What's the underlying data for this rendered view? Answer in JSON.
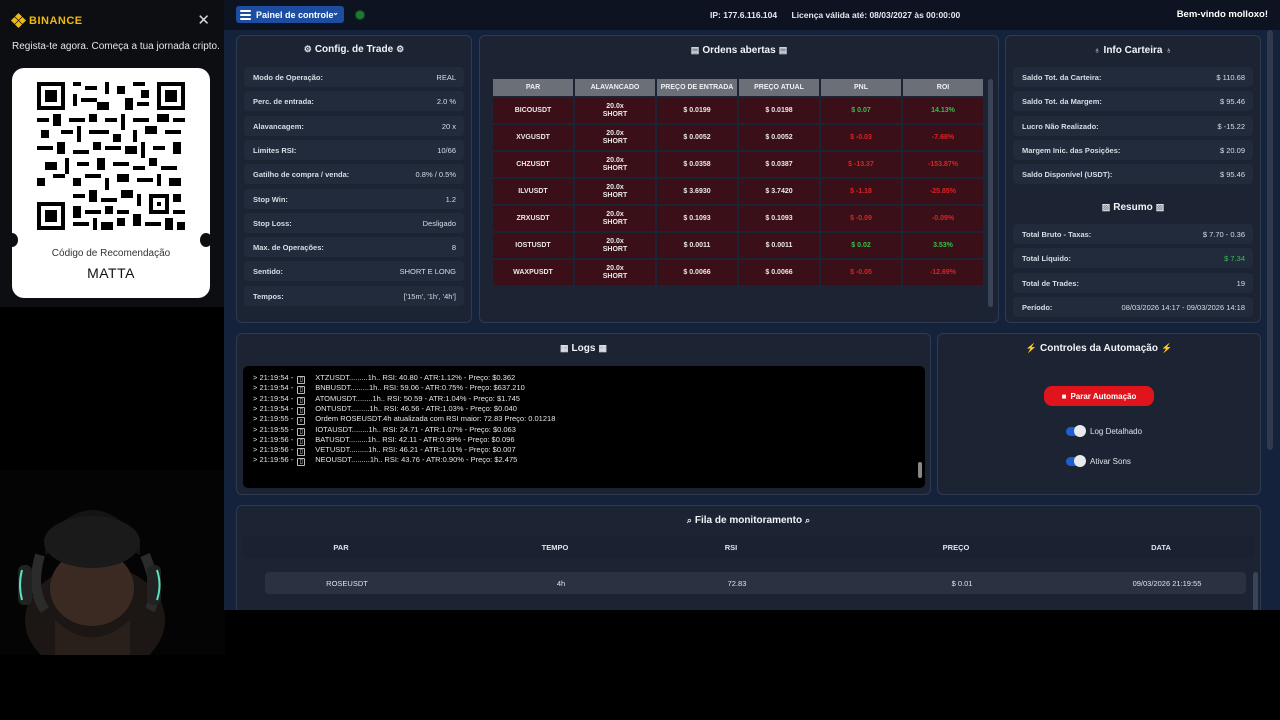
{
  "binance": {
    "brand": "BINANCE",
    "close_glyph": "✕",
    "tagline": "Regista-te agora. Começa a tua jornada cripto.",
    "referral_label": "Código de Recomendação",
    "referral_code": "MATTA"
  },
  "topbar": {
    "menu_label": "Painel de controle",
    "menu_chevron": "⌄",
    "ip": "IP: 177.6.116.104",
    "license": "Licença válida até: 08/03/2027 às 00:00:00",
    "welcome": "Bem-vindo molloxo!",
    "status_color": "#1e7a2e"
  },
  "config": {
    "title": "Config. de Trade",
    "icon": "gear-icon",
    "rows": [
      {
        "label": "Modo de Operação:",
        "value": "REAL"
      },
      {
        "label": "Perc. de entrada:",
        "value": "2.0 %"
      },
      {
        "label": "Alavancagem:",
        "value": "20 x"
      },
      {
        "label": "Limites RSI:",
        "value": "10/66"
      },
      {
        "label": "Gatilho de compra / venda:",
        "value": "0.8% / 0.5%"
      },
      {
        "label": "Stop Win:",
        "value": "1.2"
      },
      {
        "label": "Stop Loss:",
        "value": "Desligado"
      },
      {
        "label": "Max. de Operações:",
        "value": "8"
      },
      {
        "label": "Sentido:",
        "value": "SHORT E LONG"
      },
      {
        "label": "Tempos:",
        "value": "['15m', '1h', '4h']"
      }
    ]
  },
  "orders": {
    "title": "Ordens abertas",
    "headers": [
      "PAR",
      "ALAVANCADO",
      "PREÇO DE ENTRADA",
      "PREÇO ATUAL",
      "PNL",
      "ROI"
    ],
    "rows": [
      {
        "pair": "BICOUSDT",
        "lev1": "20.0x",
        "lev2": "SHORT",
        "entry": "$ 0.0199",
        "current": "$ 0.0198",
        "pnl": "$ 0.07",
        "roi": "14.13%",
        "sign": "pos"
      },
      {
        "pair": "XVGUSDT",
        "lev1": "20.0x",
        "lev2": "SHORT",
        "entry": "$ 0.0052",
        "current": "$ 0.0052",
        "pnl": "$ -0.03",
        "roi": "-7.68%",
        "sign": "neg"
      },
      {
        "pair": "CHZUSDT",
        "lev1": "20.0x",
        "lev2": "SHORT",
        "entry": "$ 0.0358",
        "current": "$ 0.0387",
        "pnl": "$ -13.37",
        "roi": "-153.87%",
        "sign": "neg"
      },
      {
        "pair": "ILVUSDT",
        "lev1": "20.0x",
        "lev2": "SHORT",
        "entry": "$ 3.6930",
        "current": "$ 3.7420",
        "pnl": "$ -1.18",
        "roi": "-25.85%",
        "sign": "neg"
      },
      {
        "pair": "ZRXUSDT",
        "lev1": "20.0x",
        "lev2": "SHORT",
        "entry": "$ 0.1093",
        "current": "$ 0.1093",
        "pnl": "$ -0.09",
        "roi": "-0.09%",
        "sign": "neg"
      },
      {
        "pair": "IOSTUSDT",
        "lev1": "20.0x",
        "lev2": "SHORT",
        "entry": "$ 0.0011",
        "current": "$ 0.0011",
        "pnl": "$ 0.02",
        "roi": "3.53%",
        "sign": "pos"
      },
      {
        "pair": "WAXPUSDT",
        "lev1": "20.0x",
        "lev2": "SHORT",
        "entry": "$ 0.0066",
        "current": "$ 0.0066",
        "pnl": "$ -0.05",
        "roi": "-12.69%",
        "sign": "neg"
      }
    ]
  },
  "wallet": {
    "title": "Info Carteira",
    "rows": [
      {
        "label": "Saldo Tot. da Carteira:",
        "value": "$ 110.68"
      },
      {
        "label": "Saldo Tot. da Margem:",
        "value": "$ 95.46"
      },
      {
        "label": "Lucro Não Realizado:",
        "value": "$ -15.22"
      },
      {
        "label": "Margem Inic. das Posições:",
        "value": "$ 20.09"
      },
      {
        "label": "Saldo Disponível (USDT):",
        "value": "$ 95.46"
      }
    ],
    "summary_title": "Resumo",
    "summary": [
      {
        "label": "Total Bruto - Taxas:",
        "value": "$ 7.70 - 0.36"
      },
      {
        "label": "Total Líquido:",
        "value": "$ 7.34"
      },
      {
        "label": "Total de Trades:",
        "value": "19"
      },
      {
        "label": "Período:",
        "value": "08/03/2026 14:17 - 09/03/2026 14:18"
      }
    ]
  },
  "logs": {
    "title": "Logs",
    "lines": [
      {
        "time": "> 21:19:54 -",
        "icon": "▯",
        "text": "XTZUSDT.........1h.. RSI: 40.80 - ATR:1.12% - Preço: $0.362"
      },
      {
        "time": "> 21:19:54 -",
        "icon": "▯",
        "text": "BNBUSDT.........1h.. RSI: 59.06 - ATR:0.75% - Preço: $637.210"
      },
      {
        "time": "> 21:19:54 -",
        "icon": "▯",
        "text": "ATOMUSDT........1h.. RSI: 50.59 - ATR:1.04% - Preço: $1.745"
      },
      {
        "time": "> 21:19:54 -",
        "icon": "▯",
        "text": "ONTUSDT.........1h.. RSI: 46.56 - ATR:1.03% - Preço: $0.040"
      },
      {
        "time": "> 21:19:55 -",
        "icon": "⌕",
        "text": "Ordem ROSEUSDT.4h atualizada com RSI maior: 72.83 Preço: 0.01218"
      },
      {
        "time": "> 21:19:55 -",
        "icon": "▯",
        "text": "IOTAUSDT........1h.. RSI: 24.71 - ATR:1.07% - Preço: $0.063"
      },
      {
        "time": "> 21:19:56 -",
        "icon": "▯",
        "text": "BATUSDT.........1h.. RSI: 42.11 - ATR:0.99% - Preço: $0.096"
      },
      {
        "time": "> 21:19:56 -",
        "icon": "▯",
        "text": "VETUSDT.........1h.. RSI: 46.21 - ATR:1.01% - Preço: $0.007"
      },
      {
        "time": "> 21:19:56 -",
        "icon": "▯",
        "text": "NEOUSDT.........1h.. RSI: 43.76 - ATR:0.90% - Preço: $2.475"
      }
    ]
  },
  "automation": {
    "title": "Controles da Automação",
    "stop_label": "Parar Automação",
    "toggle1": "Log Detalhado",
    "toggle2": "Ativar Sons"
  },
  "queue": {
    "title": "Fila de monitoramento",
    "headers": [
      "PAR",
      "TEMPO",
      "RSI",
      "PREÇO",
      "DATA"
    ],
    "rows": [
      {
        "pair": "ROSEUSDT",
        "time": "4h",
        "rsi": "72.83",
        "price": "$ 0.01",
        "date": "09/03/2026 21:19:55"
      }
    ]
  },
  "colors": {
    "positive": "#35c04a",
    "negative": "#e02222",
    "accent": "#1d4da0",
    "stop_button": "#e0141d",
    "binance_gold": "#f0b90b"
  }
}
